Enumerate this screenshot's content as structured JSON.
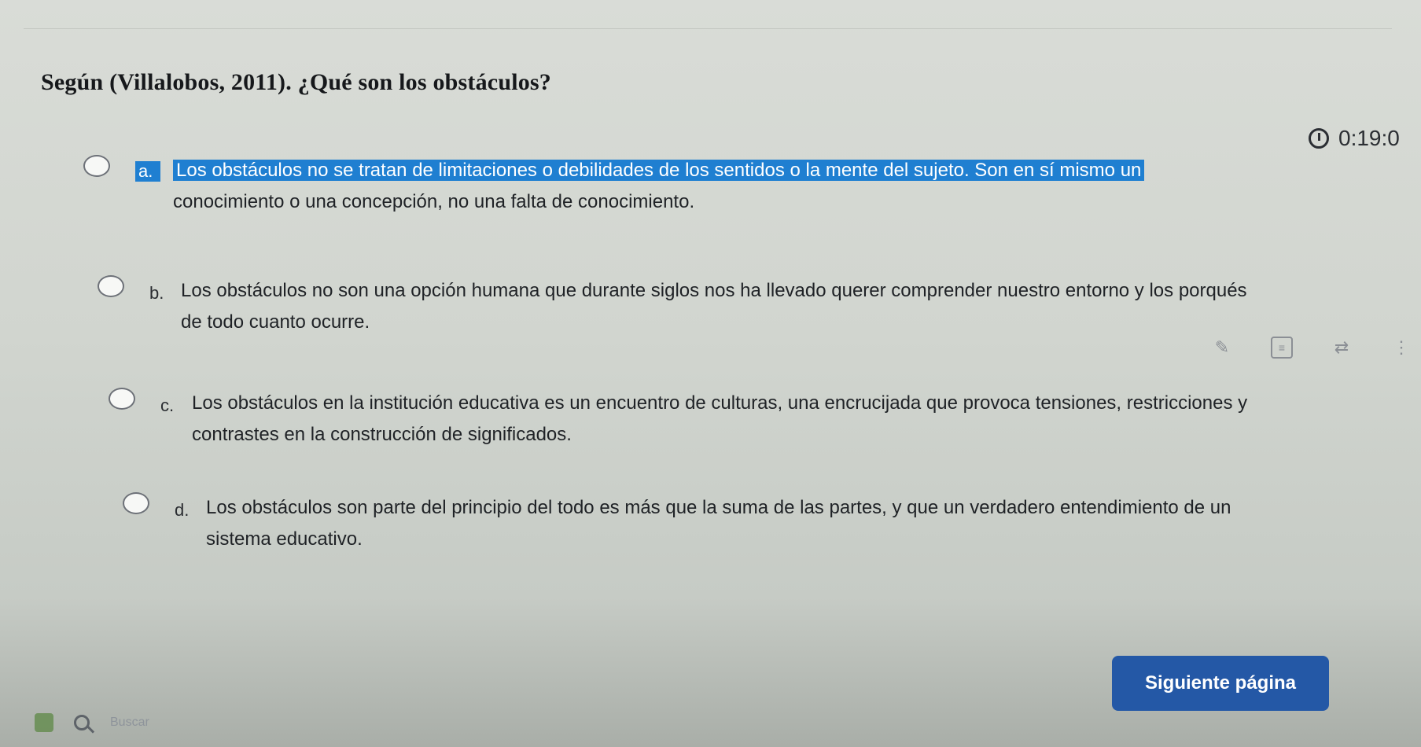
{
  "question": {
    "text": "Según (Villalobos, 2011). ¿Qué son los obstáculos?"
  },
  "timer": {
    "value": "0:19:0"
  },
  "options": [
    {
      "letter": "a.",
      "text_part1": "Los obstáculos no se tratan de limitaciones o debilidades de los sentidos o la mente del sujeto. Son en sí mismo un",
      "text_part2": "conocimiento o una concepción, no una falta de conocimiento."
    },
    {
      "letter": "b.",
      "text": "Los obstáculos no son una opción humana que durante siglos nos ha llevado querer comprender nuestro entorno y los porqués de todo cuanto ocurre."
    },
    {
      "letter": "c.",
      "text": "Los obstáculos en la institución educativa es un encuentro de culturas, una encrucijada que provoca tensiones, restricciones y contrastes en la construcción de significados."
    },
    {
      "letter": "d.",
      "text": "Los obstáculos son parte del principio del todo es más que la suma de las partes, y que un verdadero entendimiento de un sistema educativo."
    }
  ],
  "tools": {
    "pencil_icon": "pencil-icon",
    "doc_icon": "document-icon",
    "translate_icon": "translate-icon",
    "more_icon": "more-icon"
  },
  "next_button": {
    "label": "Siguiente página"
  },
  "taskbar": {
    "search_placeholder": "Buscar"
  }
}
